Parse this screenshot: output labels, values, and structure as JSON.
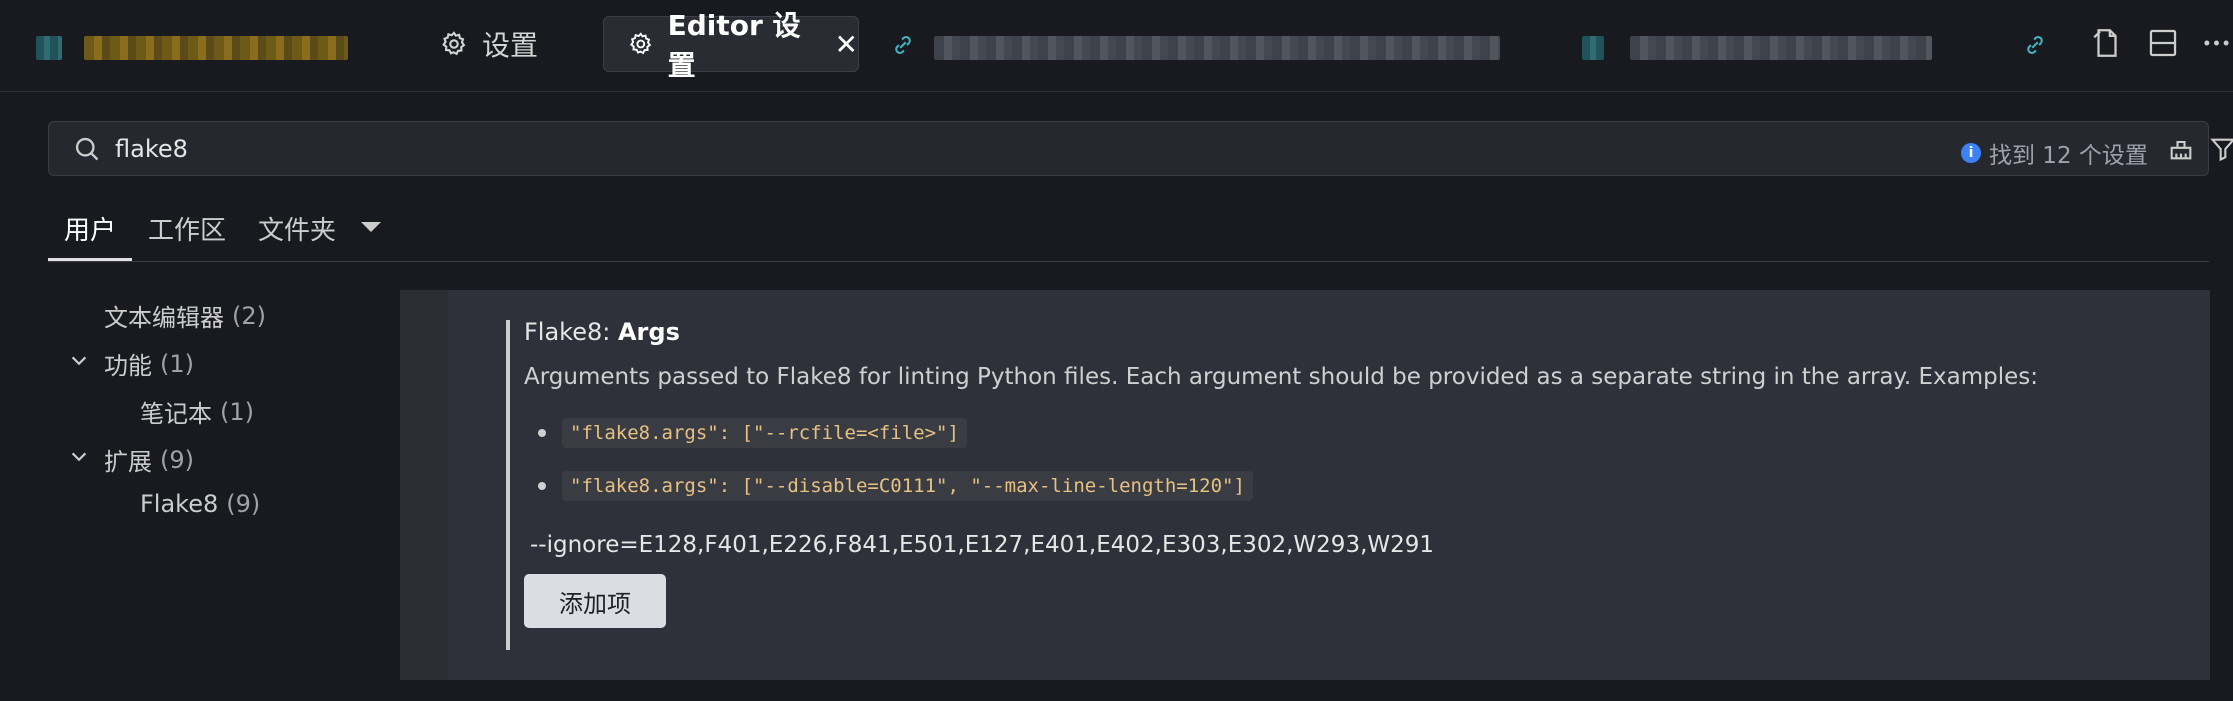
{
  "tabs": {
    "settings_label": "设置",
    "editor_settings_label": "Editor 设置",
    "close_glyph": "✕"
  },
  "search": {
    "value": "flake8",
    "found_text": "找到 12 个设置",
    "info_glyph": "i"
  },
  "scopes": {
    "user": "用户",
    "workspace": "工作区",
    "folder": "文件夹"
  },
  "toc": {
    "text_editor": {
      "label": "文本编辑器",
      "count": "(2)"
    },
    "features": {
      "label": "功能",
      "count": "(1)"
    },
    "notebook": {
      "label": "笔记本",
      "count": "(1)"
    },
    "extensions": {
      "label": "扩展",
      "count": "(9)"
    },
    "flake8": {
      "label": "Flake8",
      "count": "(9)"
    }
  },
  "setting": {
    "category": "Flake8: ",
    "name": "Args",
    "description": "Arguments passed to Flake8 for linting Python files. Each argument should be provided as a separate string in the array. Examples:",
    "example1": "\"flake8.args\": [\"--rcfile=<file>\"]",
    "example2": "\"flake8.args\": [\"--disable=C0111\", \"--max-line-length=120\"]",
    "value": "--ignore=E128,F401,E226,F841,E501,E127,E401,E402,E303,E302,W293,W291",
    "add_item": "添加项"
  },
  "colors": {
    "background": "#181a1f",
    "panel": "#2f313a",
    "accent_link": "#3fb6c4",
    "info_blue": "#3b82f6",
    "code_text": "#e7c181"
  }
}
